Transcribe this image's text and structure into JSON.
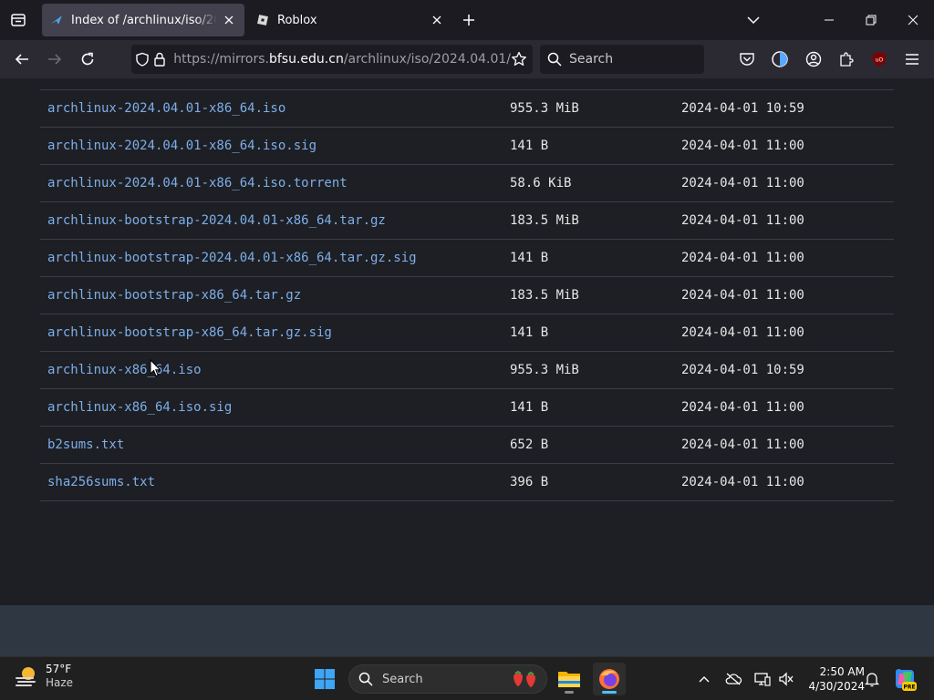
{
  "browser": {
    "tabs": [
      {
        "title": "Index of /archlinux/iso/2024.04.01/",
        "active": true
      },
      {
        "title": "Roblox",
        "active": false
      }
    ],
    "url": {
      "prefix": "https://mirrors.",
      "domain": "bfsu.edu.cn",
      "path": "/archlinux/iso/2024.04.01/"
    },
    "search_placeholder": "Search"
  },
  "listing": {
    "rows": [
      {
        "name": "archlinux-2024.04.01-x86_64.iso",
        "size": "955.3 MiB",
        "date": "2024-04-01 10:59"
      },
      {
        "name": "archlinux-2024.04.01-x86_64.iso.sig",
        "size": "141 B",
        "date": "2024-04-01 11:00"
      },
      {
        "name": "archlinux-2024.04.01-x86_64.iso.torrent",
        "size": "58.6 KiB",
        "date": "2024-04-01 11:00"
      },
      {
        "name": "archlinux-bootstrap-2024.04.01-x86_64.tar.gz",
        "size": "183.5 MiB",
        "date": "2024-04-01 11:00"
      },
      {
        "name": "archlinux-bootstrap-2024.04.01-x86_64.tar.gz.sig",
        "size": "141 B",
        "date": "2024-04-01 11:00"
      },
      {
        "name": "archlinux-bootstrap-x86_64.tar.gz",
        "size": "183.5 MiB",
        "date": "2024-04-01 11:00"
      },
      {
        "name": "archlinux-bootstrap-x86_64.tar.gz.sig",
        "size": "141 B",
        "date": "2024-04-01 11:00"
      },
      {
        "name": "archlinux-x86_64.iso",
        "size": "955.3 MiB",
        "date": "2024-04-01 10:59"
      },
      {
        "name": "archlinux-x86_64.iso.sig",
        "size": "141 B",
        "date": "2024-04-01 11:00"
      },
      {
        "name": "b2sums.txt",
        "size": "652 B",
        "date": "2024-04-01 11:00"
      },
      {
        "name": "sha256sums.txt",
        "size": "396 B",
        "date": "2024-04-01 11:00"
      }
    ]
  },
  "taskbar": {
    "weather": {
      "temp": "57°F",
      "condition": "Haze"
    },
    "search_placeholder": "Search",
    "time": "2:50 AM",
    "date": "4/30/2024"
  },
  "colors": {
    "link": "#7eaee9",
    "page_bg": "#1d1f24",
    "toolbar_bg": "#2b2a33",
    "tabbar_bg": "#1c1b22",
    "accent": "#4cc2ff"
  }
}
